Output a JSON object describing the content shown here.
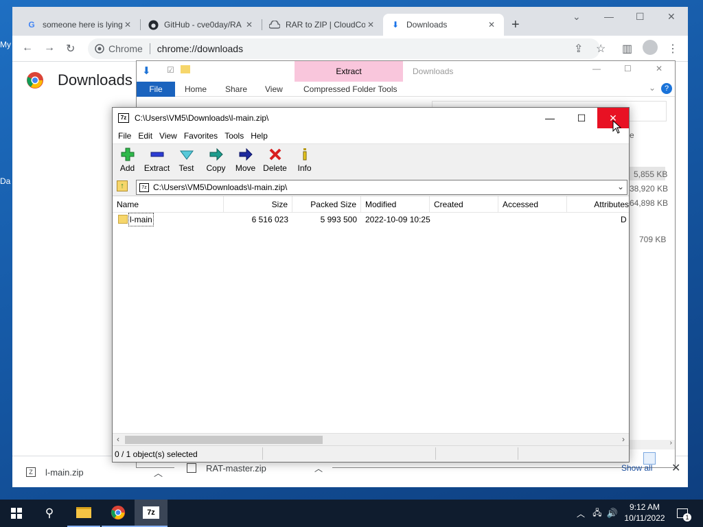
{
  "desktop": {
    "icon_labels": [
      "My",
      "Da"
    ]
  },
  "chrome": {
    "tabs": [
      {
        "title": "someone here is lying",
        "close": "✕"
      },
      {
        "title": "GitHub - cve0day/RA",
        "close": "✕"
      },
      {
        "title": "RAR to ZIP | CloudCo",
        "close": "✕"
      },
      {
        "title": "Downloads",
        "close": "✕"
      }
    ],
    "new_tab": "+",
    "secure_label": "Chrome",
    "url": "chrome://downloads",
    "page_title": "Downloads",
    "shelf": {
      "items": [
        {
          "name": "l-main.zip"
        },
        {
          "name": "RAT-master.zip"
        }
      ],
      "show_all": "Show all"
    }
  },
  "explorer": {
    "title": "Downloads",
    "context_tab": "Extract",
    "ribbon_tabs": [
      "File",
      "Home",
      "Share",
      "View",
      "Compressed Folder Tools"
    ],
    "right_values": [
      "e",
      "5,855 KB",
      "38,920 KB",
      "64,898 KB",
      "709 KB"
    ]
  },
  "sevenzip": {
    "title": "C:\\Users\\VM5\\Downloads\\l-main.zip\\",
    "menu": [
      "File",
      "Edit",
      "View",
      "Favorites",
      "Tools",
      "Help"
    ],
    "toolbar": [
      "Add",
      "Extract",
      "Test",
      "Copy",
      "Move",
      "Delete",
      "Info"
    ],
    "address": "C:\\Users\\VM5\\Downloads\\l-main.zip\\",
    "columns": [
      "Name",
      "Size",
      "Packed Size",
      "Modified",
      "Created",
      "Accessed",
      "Attributes"
    ],
    "rows": [
      {
        "name": "l-main",
        "size": "6 516 023",
        "packed": "5 993 500",
        "modified": "2022-10-09 10:25",
        "created": "",
        "accessed": "",
        "attr": "D"
      }
    ],
    "status": "0 / 1 object(s) selected"
  },
  "taskbar": {
    "time": "9:12 AM",
    "date": "10/11/2022",
    "notification_count": "1"
  }
}
